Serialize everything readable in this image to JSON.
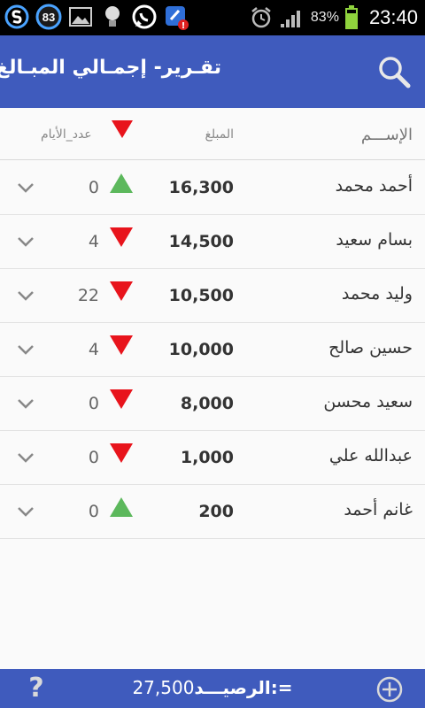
{
  "status_bar": {
    "notification_badge": "83",
    "battery_percent": "83%",
    "time": "23:40"
  },
  "app_bar": {
    "title": "تقـرير- إجمـالي المبـالغ"
  },
  "columns": {
    "name": "الإســـم",
    "amount": "المبلغ",
    "days": "عدد_الأيام"
  },
  "rows": [
    {
      "name": "أحمد محمد",
      "amount": "16,300",
      "days": "0",
      "trend": "up"
    },
    {
      "name": "بسام سعيد",
      "amount": "14,500",
      "days": "4",
      "trend": "down"
    },
    {
      "name": "وليد محمد",
      "amount": "10,500",
      "days": "22",
      "trend": "down"
    },
    {
      "name": "حسين صالح",
      "amount": "10,000",
      "days": "4",
      "trend": "down"
    },
    {
      "name": "سعيد محسن",
      "amount": "8,000",
      "days": "0",
      "trend": "down"
    },
    {
      "name": "عبدالله علي",
      "amount": "1,000",
      "days": "0",
      "trend": "down"
    },
    {
      "name": "غانم أحمد",
      "amount": "200",
      "days": "0",
      "trend": "up"
    }
  ],
  "bottom_bar": {
    "balance_label": "الرصيـــد:=",
    "balance_value": "27,500",
    "help_label": "?"
  },
  "colors": {
    "primary": "#3f5bbd",
    "trend_up": "#5cb85c",
    "trend_down": "#e8141c"
  },
  "icons": {
    "search": "search-icon",
    "add": "add-circle-icon",
    "help": "help-icon",
    "expand": "chevron-down-icon",
    "trend_up": "triangle-up-icon",
    "trend_down": "triangle-down-icon"
  }
}
